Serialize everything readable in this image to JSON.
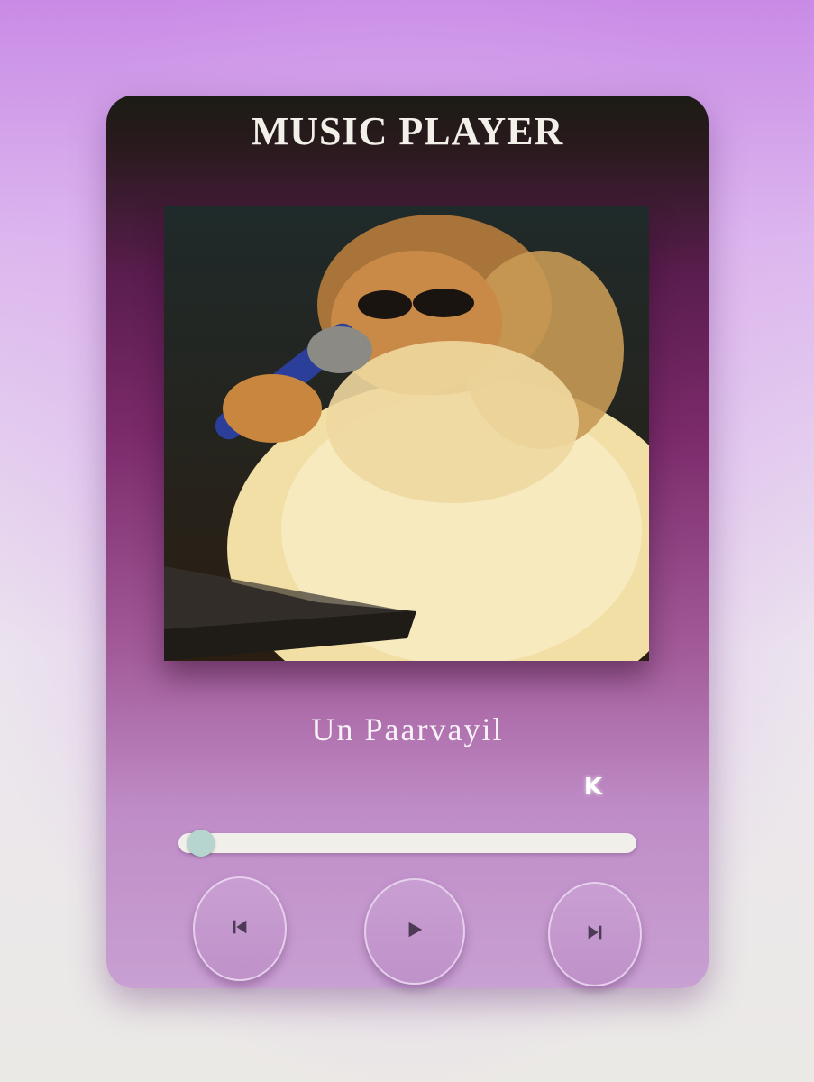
{
  "player": {
    "title": "MUSIC PLAYER",
    "album_art": {
      "icon": "album-cover-image"
    },
    "song_title": "Un Paarvayil",
    "time_readout": "K",
    "seek_progress": 0.02,
    "controls": {
      "prev_icon": "skip-previous-icon",
      "play_icon": "play-icon",
      "next_icon": "skip-next-icon"
    },
    "colors": {
      "card_top": "#1c1b14",
      "card_mid": "#7b2a6a",
      "card_bottom": "#c8a0d2",
      "seek_track": "#f1efe9",
      "seek_thumb": "#b7d5cf"
    }
  }
}
